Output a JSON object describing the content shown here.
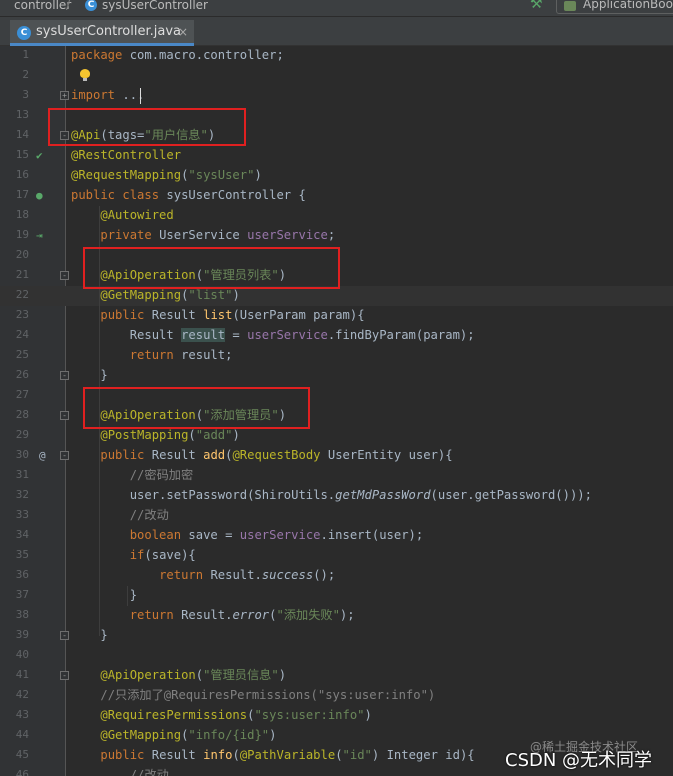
{
  "breadcrumb": {
    "package": "controller",
    "file": "sysUserController"
  },
  "run_config": {
    "label": "ApplicationBoot"
  },
  "tab": {
    "label": "sysUserController.java",
    "close": "×"
  },
  "import_fold": "...",
  "code_lines": [
    {
      "n": "1",
      "tokens": [
        {
          "c": "kw",
          "t": "package "
        },
        {
          "c": "",
          "t": "com.macro.controller;"
        }
      ]
    },
    {
      "n": "2",
      "tokens": []
    },
    {
      "n": "3",
      "tokens": [
        {
          "c": "kw",
          "t": "import "
        },
        {
          "c": "",
          "t": "..."
        }
      ]
    },
    {
      "n": "13",
      "tokens": []
    },
    {
      "n": "14",
      "tokens": [
        {
          "c": "ann",
          "t": "@Api"
        },
        {
          "c": "",
          "t": "(tags="
        },
        {
          "c": "str",
          "t": "\"用户信息\""
        },
        {
          "c": "",
          "t": ")"
        }
      ]
    },
    {
      "n": "15",
      "tokens": [
        {
          "c": "ann",
          "t": "@RestController"
        }
      ]
    },
    {
      "n": "16",
      "tokens": [
        {
          "c": "ann",
          "t": "@RequestMapping"
        },
        {
          "c": "",
          "t": "("
        },
        {
          "c": "str",
          "t": "\"sysUser\""
        },
        {
          "c": "",
          "t": ")"
        }
      ]
    },
    {
      "n": "17",
      "tokens": [
        {
          "c": "kw",
          "t": "public class "
        },
        {
          "c": "",
          "t": "sysUserController {"
        }
      ]
    },
    {
      "n": "18",
      "tokens": [
        {
          "c": "",
          "t": "    "
        },
        {
          "c": "ann",
          "t": "@Autowired"
        }
      ]
    },
    {
      "n": "19",
      "tokens": [
        {
          "c": "",
          "t": "    "
        },
        {
          "c": "kw",
          "t": "private "
        },
        {
          "c": "",
          "t": "UserService "
        },
        {
          "c": "field",
          "t": "userService"
        },
        {
          "c": "",
          "t": ";"
        }
      ]
    },
    {
      "n": "20",
      "tokens": []
    },
    {
      "n": "21",
      "tokens": [
        {
          "c": "",
          "t": "    "
        },
        {
          "c": "ann",
          "t": "@ApiOperation"
        },
        {
          "c": "",
          "t": "("
        },
        {
          "c": "str",
          "t": "\"管理员列表\""
        },
        {
          "c": "",
          "t": ")"
        }
      ]
    },
    {
      "n": "22",
      "tokens": [
        {
          "c": "",
          "t": "    "
        },
        {
          "c": "ann",
          "t": "@GetMapping"
        },
        {
          "c": "",
          "t": "("
        },
        {
          "c": "str",
          "t": "\"list\""
        },
        {
          "c": "",
          "t": ")"
        }
      ]
    },
    {
      "n": "23",
      "tokens": [
        {
          "c": "",
          "t": "    "
        },
        {
          "c": "kw",
          "t": "public "
        },
        {
          "c": "",
          "t": "Result "
        },
        {
          "c": "mth",
          "t": "list"
        },
        {
          "c": "",
          "t": "(UserParam param){"
        }
      ]
    },
    {
      "n": "24",
      "tokens": [
        {
          "c": "",
          "t": "        Result "
        },
        {
          "c": "hl",
          "t": "result"
        },
        {
          "c": "",
          "t": " = "
        },
        {
          "c": "field",
          "t": "userService"
        },
        {
          "c": "",
          "t": ".findByParam(param);"
        }
      ]
    },
    {
      "n": "25",
      "tokens": [
        {
          "c": "",
          "t": "        "
        },
        {
          "c": "kw",
          "t": "return "
        },
        {
          "c": "",
          "t": "result;"
        }
      ]
    },
    {
      "n": "26",
      "tokens": [
        {
          "c": "",
          "t": "    }"
        }
      ]
    },
    {
      "n": "27",
      "tokens": []
    },
    {
      "n": "28",
      "tokens": [
        {
          "c": "",
          "t": "    "
        },
        {
          "c": "ann",
          "t": "@ApiOperation"
        },
        {
          "c": "",
          "t": "("
        },
        {
          "c": "str",
          "t": "\"添加管理员\""
        },
        {
          "c": "",
          "t": ")"
        }
      ]
    },
    {
      "n": "29",
      "tokens": [
        {
          "c": "",
          "t": "    "
        },
        {
          "c": "ann",
          "t": "@PostMapping"
        },
        {
          "c": "",
          "t": "("
        },
        {
          "c": "str",
          "t": "\"add\""
        },
        {
          "c": "",
          "t": ")"
        }
      ]
    },
    {
      "n": "30",
      "tokens": [
        {
          "c": "",
          "t": "    "
        },
        {
          "c": "kw",
          "t": "public "
        },
        {
          "c": "",
          "t": "Result "
        },
        {
          "c": "mth",
          "t": "add"
        },
        {
          "c": "",
          "t": "("
        },
        {
          "c": "ann",
          "t": "@RequestBody "
        },
        {
          "c": "",
          "t": "UserEntity user){"
        }
      ]
    },
    {
      "n": "31",
      "tokens": [
        {
          "c": "",
          "t": "        "
        },
        {
          "c": "cmt",
          "t": "//密码加密"
        }
      ]
    },
    {
      "n": "32",
      "tokens": [
        {
          "c": "",
          "t": "        user.setPassword(ShiroUtils."
        },
        {
          "c": "ital",
          "t": "getMdPassWord"
        },
        {
          "c": "",
          "t": "(user.getPassword()));"
        }
      ]
    },
    {
      "n": "33",
      "tokens": [
        {
          "c": "",
          "t": "        "
        },
        {
          "c": "cmt",
          "t": "//改动"
        }
      ]
    },
    {
      "n": "34",
      "tokens": [
        {
          "c": "",
          "t": "        "
        },
        {
          "c": "kw",
          "t": "boolean "
        },
        {
          "c": "",
          "t": "save = "
        },
        {
          "c": "field",
          "t": "userService"
        },
        {
          "c": "",
          "t": ".insert(user);"
        }
      ]
    },
    {
      "n": "35",
      "tokens": [
        {
          "c": "",
          "t": "        "
        },
        {
          "c": "kw",
          "t": "if"
        },
        {
          "c": "",
          "t": "(save){"
        }
      ]
    },
    {
      "n": "36",
      "tokens": [
        {
          "c": "",
          "t": "            "
        },
        {
          "c": "kw",
          "t": "return "
        },
        {
          "c": "",
          "t": "Result."
        },
        {
          "c": "ital",
          "t": "success"
        },
        {
          "c": "",
          "t": "();"
        }
      ]
    },
    {
      "n": "37",
      "tokens": [
        {
          "c": "",
          "t": "        }"
        }
      ]
    },
    {
      "n": "38",
      "tokens": [
        {
          "c": "",
          "t": "        "
        },
        {
          "c": "kw",
          "t": "return "
        },
        {
          "c": "",
          "t": "Result."
        },
        {
          "c": "ital",
          "t": "error"
        },
        {
          "c": "",
          "t": "("
        },
        {
          "c": "str",
          "t": "\"添加失败\""
        },
        {
          "c": "",
          "t": ");"
        }
      ]
    },
    {
      "n": "39",
      "tokens": [
        {
          "c": "",
          "t": "    }"
        }
      ]
    },
    {
      "n": "40",
      "tokens": []
    },
    {
      "n": "41",
      "tokens": [
        {
          "c": "",
          "t": "    "
        },
        {
          "c": "ann",
          "t": "@ApiOperation"
        },
        {
          "c": "",
          "t": "("
        },
        {
          "c": "str",
          "t": "\"管理员信息\""
        },
        {
          "c": "",
          "t": ")"
        }
      ]
    },
    {
      "n": "42",
      "tokens": [
        {
          "c": "",
          "t": "    "
        },
        {
          "c": "cmt",
          "t": "//只添加了@RequiresPermissions(\"sys:user:info\")"
        }
      ]
    },
    {
      "n": "43",
      "tokens": [
        {
          "c": "",
          "t": "    "
        },
        {
          "c": "ann",
          "t": "@RequiresPermissions"
        },
        {
          "c": "",
          "t": "("
        },
        {
          "c": "str",
          "t": "\"sys:user:info\""
        },
        {
          "c": "",
          "t": ")"
        }
      ]
    },
    {
      "n": "44",
      "tokens": [
        {
          "c": "",
          "t": "    "
        },
        {
          "c": "ann",
          "t": "@GetMapping"
        },
        {
          "c": "",
          "t": "("
        },
        {
          "c": "str",
          "t": "\"info/{id}\""
        },
        {
          "c": "",
          "t": ")"
        }
      ]
    },
    {
      "n": "45",
      "tokens": [
        {
          "c": "",
          "t": "    "
        },
        {
          "c": "kw",
          "t": "public "
        },
        {
          "c": "",
          "t": "Result "
        },
        {
          "c": "mth",
          "t": "info"
        },
        {
          "c": "",
          "t": "("
        },
        {
          "c": "ann",
          "t": "@PathVariable"
        },
        {
          "c": "",
          "t": "("
        },
        {
          "c": "str",
          "t": "\"id\""
        },
        {
          "c": "",
          "t": ") Integer id){"
        }
      ]
    },
    {
      "n": "46",
      "tokens": [
        {
          "c": "",
          "t": "        "
        },
        {
          "c": "cmt",
          "t": "//改动"
        }
      ]
    }
  ],
  "watermark": "@稀土掘金技术社区",
  "csdn_credit": "CSDN @无术同学",
  "colors": {
    "keyword": "#cc7832",
    "annotation": "#bbb529",
    "string": "#6a8759",
    "comment": "#808080",
    "field": "#9876aa",
    "method": "#ffc66d",
    "highlight_box": "#e02020"
  }
}
